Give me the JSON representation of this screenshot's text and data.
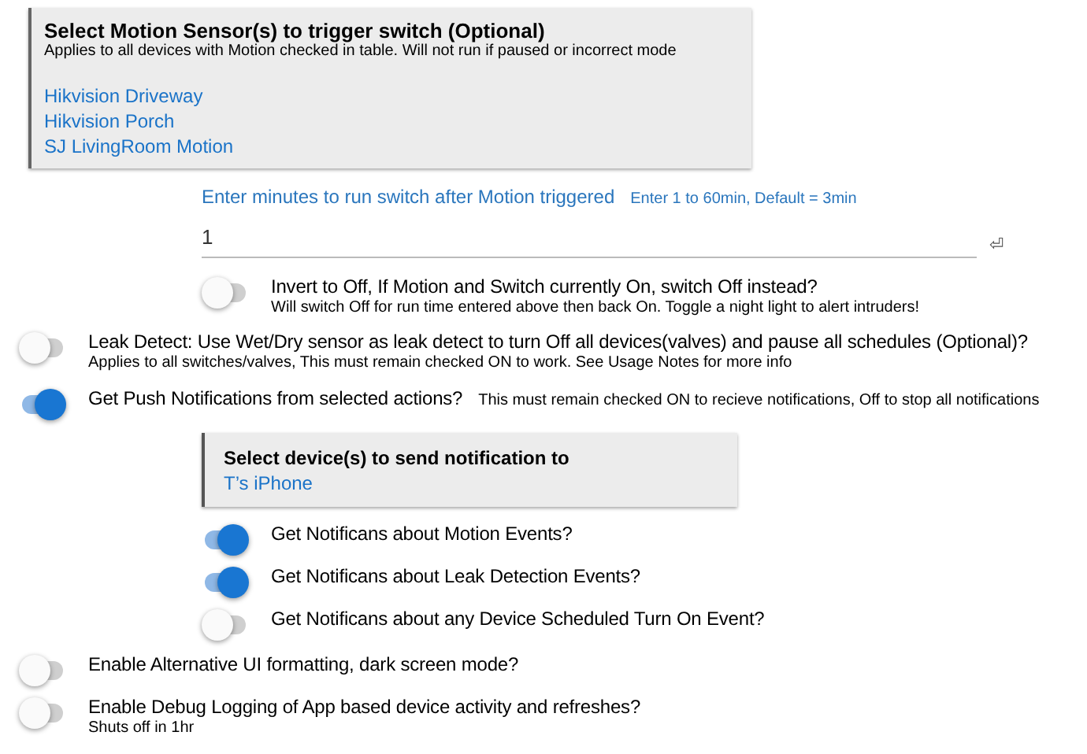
{
  "motion_box": {
    "title": "Select Motion Sensor(s) to trigger switch (Optional)",
    "subtitle": "Applies to all devices with Motion checked in table. Will not run if paused or incorrect mode",
    "devices": [
      "Hikvision Driveway",
      "Hikvision Porch",
      "SJ LivingRoom Motion"
    ]
  },
  "minutes": {
    "label": "Enter minutes to run switch after Motion triggered",
    "hint": "Enter 1 to 60min, Default = 3min",
    "value": "1",
    "enter_symbol": "⏎"
  },
  "invert": {
    "label": "Invert to Off, If Motion and Switch currently On, switch Off instead?",
    "note": "Will switch Off for run time entered above then back On. Toggle a night light to alert intruders!",
    "on": false
  },
  "leak": {
    "label": "Leak Detect: Use Wet/Dry sensor as leak detect to turn Off all devices(valves) and pause all schedules (Optional)?",
    "note": "Applies to all switches/valves, This must remain checked ON to work. See Usage Notes for more info",
    "on": false
  },
  "push": {
    "label": "Get Push Notifications from selected actions?",
    "note": "This must remain checked ON to recieve notifications, Off to stop all notifications",
    "on": true
  },
  "notify_box": {
    "title": "Select device(s) to send notification to",
    "devices": [
      "T’s iPhone"
    ]
  },
  "notify_options": [
    {
      "label": "Get Notificans about Motion Events?",
      "on": true
    },
    {
      "label": "Get Notificans about Leak Detection Events?",
      "on": true
    },
    {
      "label": "Get Notificans about any Device Scheduled Turn On Event?",
      "on": false
    }
  ],
  "alt_ui": {
    "label": "Enable Alternative UI formatting, dark screen mode?",
    "on": false
  },
  "debug": {
    "label": "Enable Debug Logging of App based device activity and refreshes?",
    "note": "Shuts off in 1hr",
    "on": false
  }
}
